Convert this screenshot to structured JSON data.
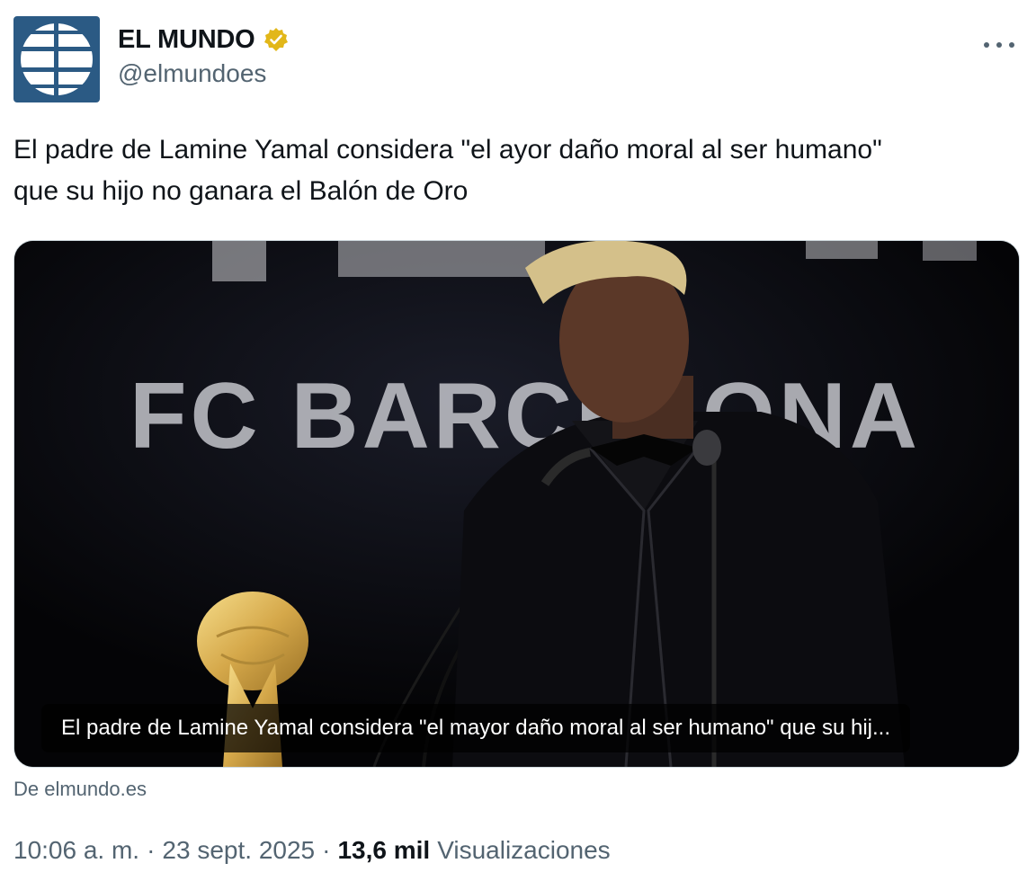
{
  "account": {
    "display_name": "EL MUNDO",
    "handle": "@elmundoes",
    "verified_badge_color": "#e2b719",
    "avatar_color": "#2b5a84"
  },
  "tweet": {
    "text_line1": "El padre de Lamine Yamal considera \"el ayor daño moral al ser humano\"",
    "text_line2": "que su hijo no ganara el Balón de Oro"
  },
  "card": {
    "image_backdrop_text": "FC BARCELONA",
    "title": "El padre de Lamine Yamal considera \"el mayor daño moral al ser humano\" que su hij...",
    "source": "De elmundo.es"
  },
  "meta": {
    "time": "10:06 a. m.",
    "separator": "·",
    "date": "23 sept. 2025",
    "views_count": "13,6 mil",
    "views_label": "Visualizaciones"
  },
  "icons": {
    "verified": "verified-badge-icon",
    "more": "more-options-icon"
  }
}
